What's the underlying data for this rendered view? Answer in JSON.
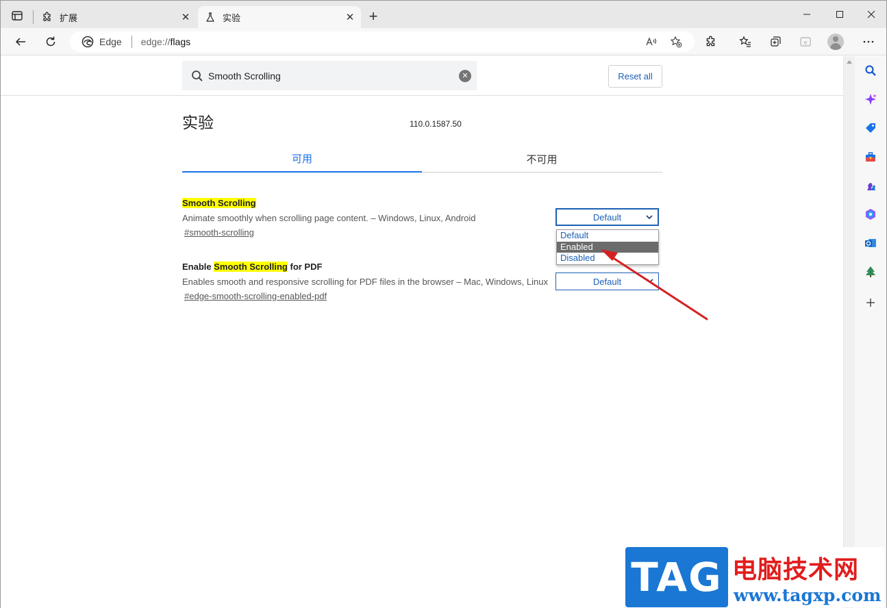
{
  "browser": {
    "tabs": [
      {
        "label": "扩展",
        "icon": "puzzle-icon",
        "close": "✕"
      },
      {
        "label": "实验",
        "icon": "flask-icon",
        "close": "✕"
      }
    ],
    "new_tab": "+",
    "window_controls": {
      "minimize": "—",
      "maximize": "☐",
      "close": "✕"
    },
    "address_bar": {
      "site_label": "Edge",
      "url_scheme": "edge://",
      "url_path": "flags"
    }
  },
  "search": {
    "value": "Smooth Scrolling",
    "clear": "✕"
  },
  "reset_all": "Reset all",
  "page": {
    "title": "实验",
    "version": "110.0.1587.50",
    "tabs": {
      "available": "可用",
      "unavailable": "不可用"
    }
  },
  "experiments": [
    {
      "name_prefix": "",
      "name_highlight": "Smooth Scrolling",
      "name_suffix": "",
      "description": "Animate smoothly when scrolling page content. – Windows, Linux, Android",
      "link": "#smooth-scrolling",
      "selected": "Default",
      "options": [
        "Default",
        "Enabled",
        "Disabled"
      ],
      "hovered_option": "Enabled"
    },
    {
      "name_prefix": "Enable ",
      "name_highlight": "Smooth Scrolling",
      "name_suffix": " for PDF",
      "description": "Enables smooth and responsive scrolling for PDF files in the browser – Mac, Windows, Linux",
      "link": "#edge-smooth-scrolling-enabled-pdf",
      "selected": "Default"
    }
  ],
  "colors": {
    "accent": "#1a73e8",
    "highlight": "#ffff00",
    "annotation_arrow": "#d62020"
  },
  "watermark": {
    "badge": "TAG",
    "title": "电脑技术网",
    "url": "www.tagxp.com"
  }
}
